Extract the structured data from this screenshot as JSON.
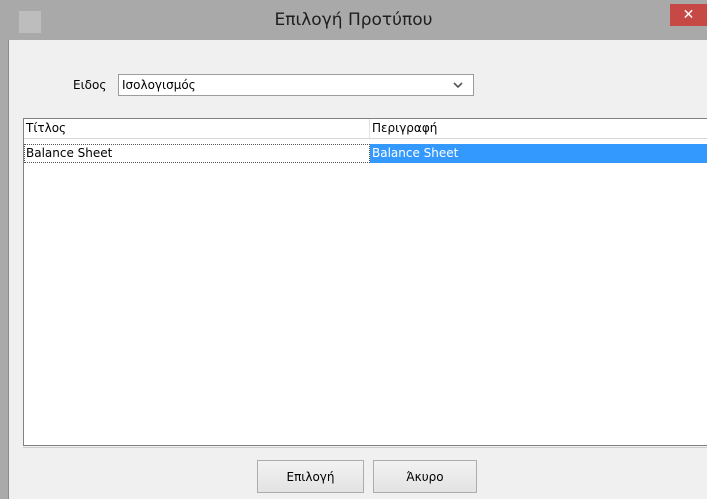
{
  "window": {
    "title": "Επιλογή Προτύπου",
    "close_symbol": "✕"
  },
  "type_field": {
    "label": "Ειδος",
    "selected": "Ισολογισμός"
  },
  "table": {
    "columns": [
      "Τίτλος",
      "Περιγραφή"
    ],
    "rows": [
      {
        "title": "Balance Sheet",
        "description": "Balance Sheet"
      }
    ]
  },
  "buttons": {
    "select": "Επιλογή",
    "cancel": "Άκυρο"
  },
  "icons": {
    "app": "app-icon",
    "close": "close-icon",
    "dropdown": "chevron-down-icon"
  },
  "colors": {
    "selection": "#3399ff",
    "close_button": "#c74946"
  }
}
